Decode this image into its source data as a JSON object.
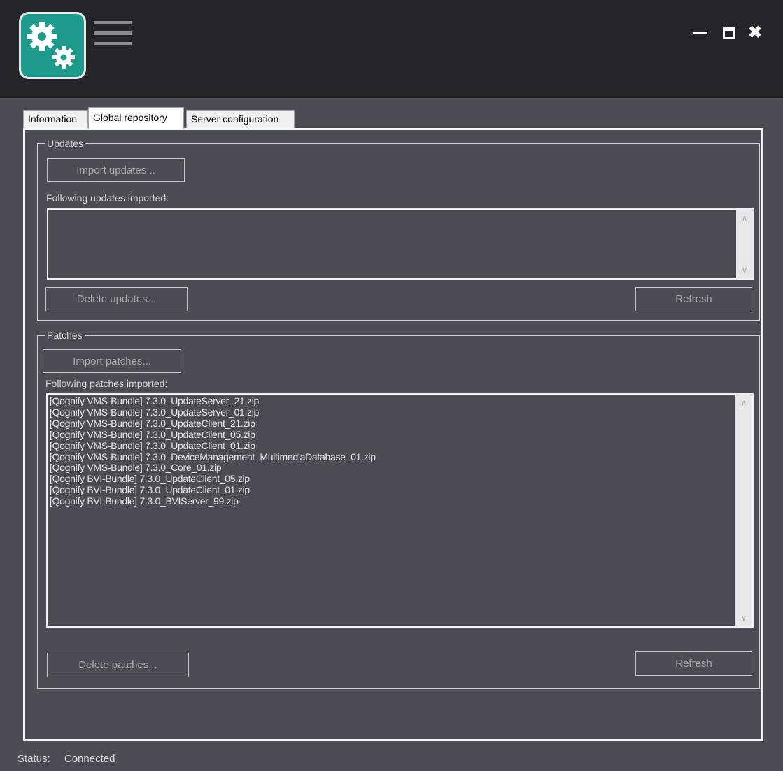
{
  "window": {
    "logo_icon": "gears-icon",
    "menu_icon": "hamburger-menu-icon",
    "controls": {
      "minimize_icon": "minimize-icon",
      "maximize_icon": "maximize-icon",
      "close_icon": "close-icon",
      "close_glyph": "✖"
    }
  },
  "tabs": [
    {
      "label": "Information",
      "active": false
    },
    {
      "label": "Global repository",
      "active": true
    },
    {
      "label": "Server configuration",
      "active": false
    }
  ],
  "updates": {
    "legend": "Updates",
    "import_label": "Import updates...",
    "list_label": "Following updates imported:",
    "items": [],
    "delete_label": "Delete updates...",
    "refresh_label": "Refresh"
  },
  "patches": {
    "legend": "Patches",
    "import_label": "Import patches...",
    "list_label": "Following patches imported:",
    "items": [
      "[Qognify VMS-Bundle] 7.3.0_UpdateServer_21.zip",
      "[Qognify VMS-Bundle] 7.3.0_UpdateServer_01.zip",
      "[Qognify VMS-Bundle] 7.3.0_UpdateClient_21.zip",
      "[Qognify VMS-Bundle] 7.3.0_UpdateClient_05.zip",
      "[Qognify VMS-Bundle] 7.3.0_UpdateClient_01.zip",
      "[Qognify VMS-Bundle] 7.3.0_DeviceManagement_MultimediaDatabase_01.zip",
      "[Qognify VMS-Bundle] 7.3.0_Core_01.zip",
      "[Qognify BVI-Bundle] 7.3.0_UpdateClient_05.zip",
      "[Qognify BVI-Bundle] 7.3.0_UpdateClient_01.zip",
      "[Qognify BVI-Bundle] 7.3.0_BVIServer_99.zip"
    ],
    "delete_label": "Delete patches...",
    "refresh_label": "Refresh"
  },
  "status": {
    "label": "Status:",
    "value": "Connected"
  },
  "scroll": {
    "up_glyph": "∧",
    "down_glyph": "∨"
  }
}
